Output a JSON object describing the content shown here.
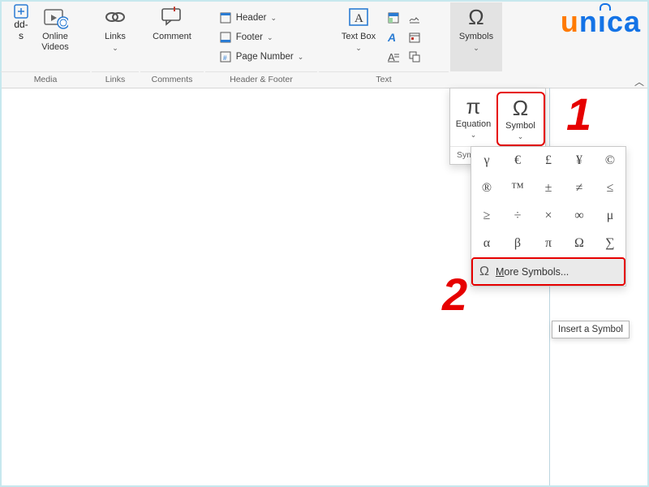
{
  "logo_text": "unica",
  "ribbon": {
    "groups": {
      "media": {
        "label": "Media",
        "addins_lbl": "dd-",
        "addins_sub": "s",
        "online_videos": "Online Videos"
      },
      "links": {
        "label": "Links",
        "btn": "Links"
      },
      "comments": {
        "label": "Comments",
        "btn": "Comment"
      },
      "header_footer": {
        "label": "Header & Footer",
        "header": "Header",
        "footer": "Footer",
        "page_number": "Page Number"
      },
      "text": {
        "label": "Text",
        "textbox": "Text Box"
      },
      "symbols": {
        "label": "Symbols",
        "btn": "Symbols"
      }
    }
  },
  "eq_sym": {
    "equation": "Equation",
    "symbol": "Symbol",
    "panel_label": "Symbols"
  },
  "gallery": {
    "rows": [
      [
        "γ",
        "€",
        "£",
        "¥",
        "©"
      ],
      [
        "®",
        "™",
        "±",
        "≠",
        "≤"
      ],
      [
        "≥",
        "÷",
        "×",
        "∞",
        "μ"
      ],
      [
        "α",
        "β",
        "π",
        "Ω",
        "∑"
      ]
    ]
  },
  "more_symbols": "More Symbols...",
  "tooltip": "Insert a Symbol",
  "annotations": {
    "one": "1",
    "two": "2"
  }
}
